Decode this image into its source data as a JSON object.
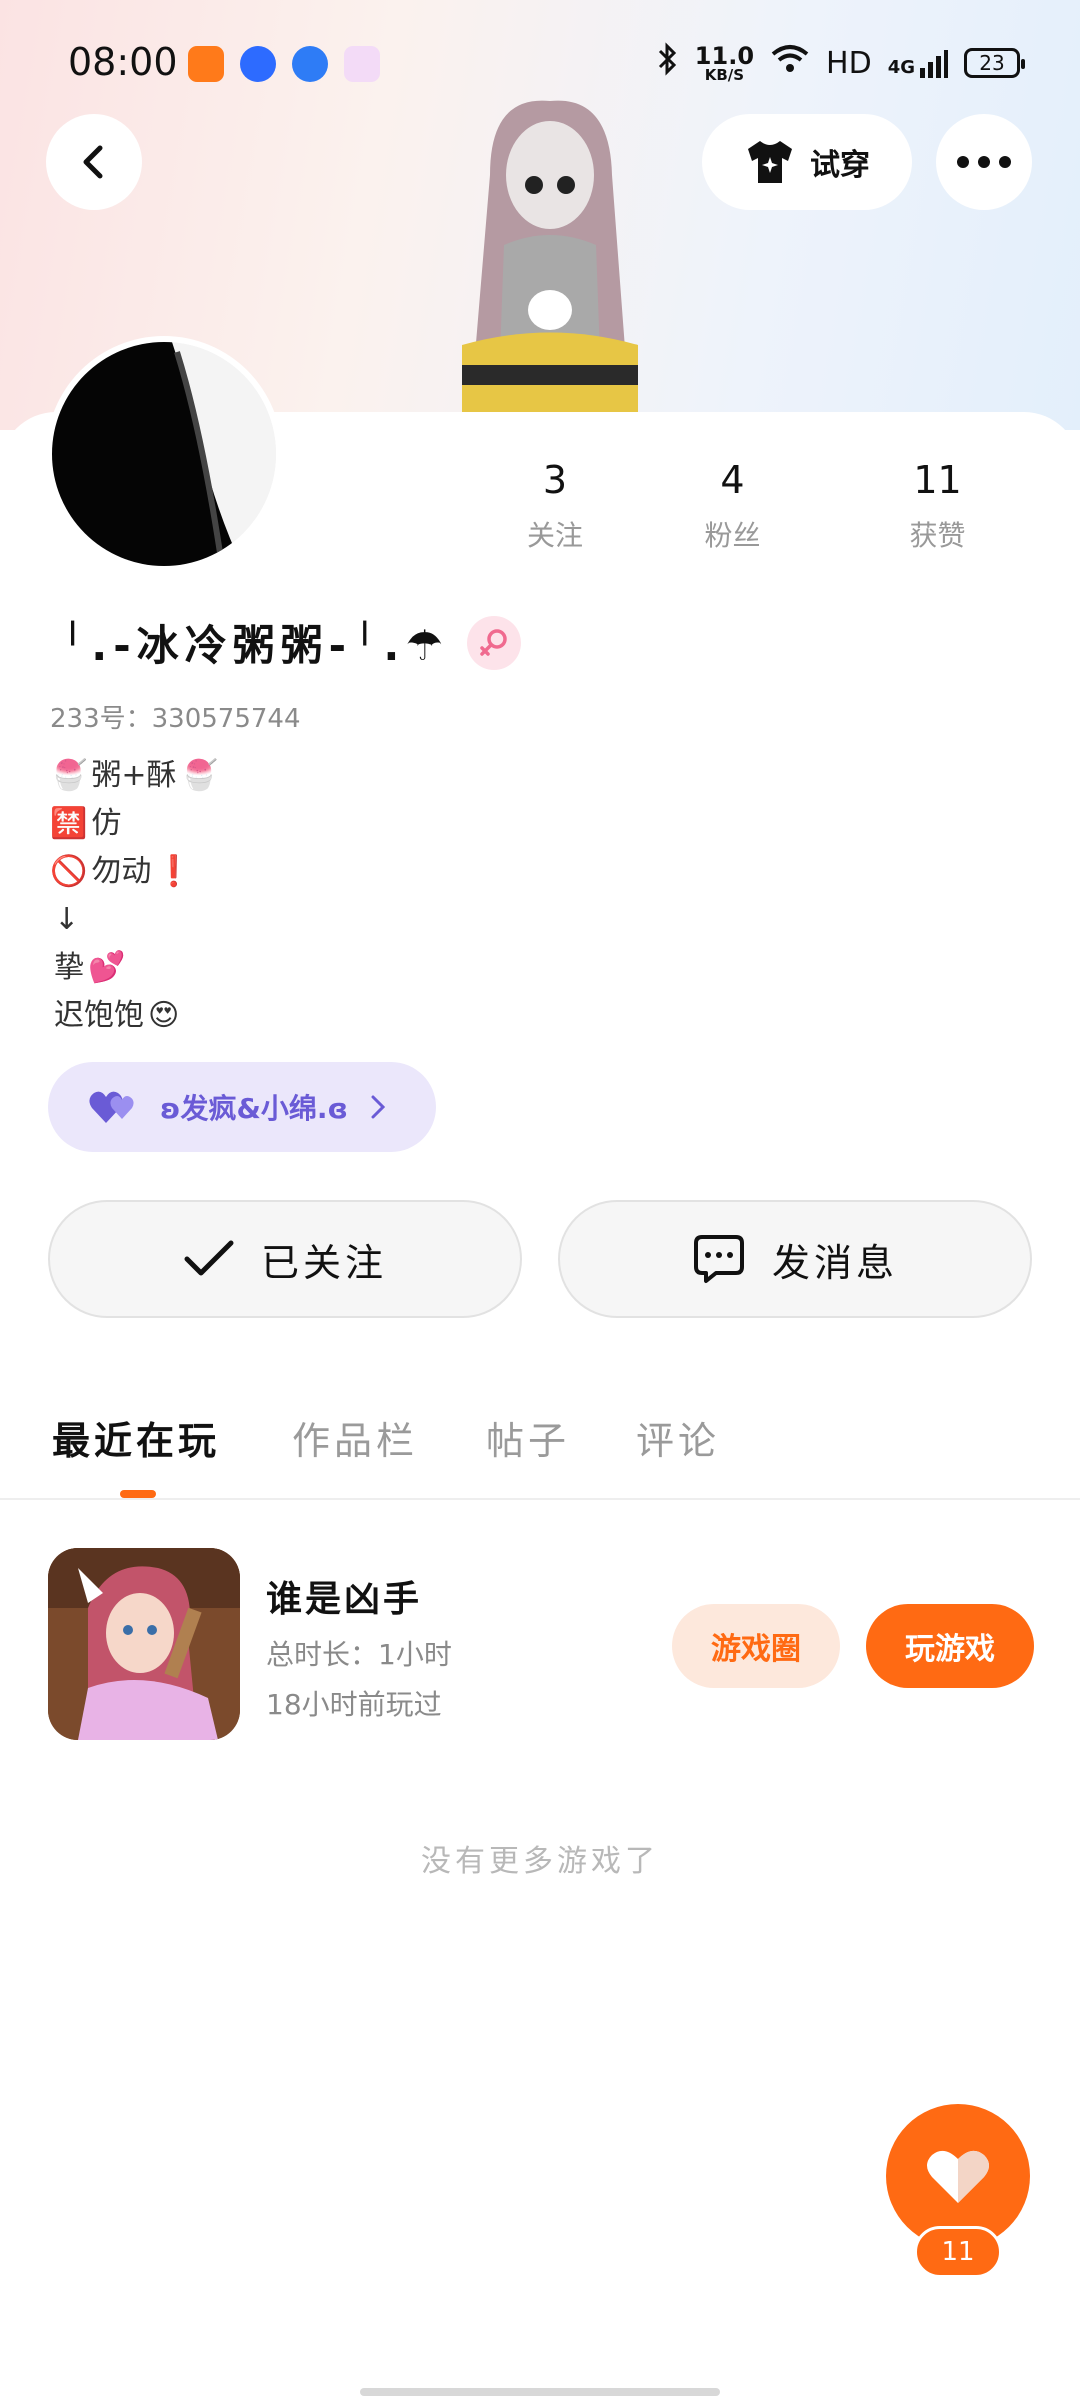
{
  "status_bar": {
    "time": "08:00",
    "net_speed_value": "11.0",
    "net_speed_unit": "KB/S",
    "hd_label": "HD",
    "signal_label": "4G",
    "battery": "23"
  },
  "header": {
    "try_on_label": "试穿"
  },
  "profile": {
    "name": "╵.-冰冷粥粥-╵.☂",
    "uid_label": "233号：",
    "uid_value": "330575744",
    "stats": [
      {
        "value": "3",
        "label": "关注"
      },
      {
        "value": "4",
        "label": "粉丝"
      },
      {
        "value": "11",
        "label": "获赞"
      }
    ],
    "bio": [
      {
        "prefix": "🍧",
        "text": "粥+酥",
        "suffix": "🍧"
      },
      {
        "prefix": "🈲",
        "text": "仿",
        "suffix": ""
      },
      {
        "prefix": "🚫",
        "text": "勿动",
        "suffix": "❗"
      },
      {
        "prefix": "",
        "text": "↓",
        "suffix": ""
      },
      {
        "prefix": "",
        "text": "挚",
        "suffix": "💕"
      },
      {
        "prefix": "",
        "text": "迟饱饱",
        "suffix": "😍"
      }
    ],
    "pair_badge": "ʚ发疯&小绵.ɞ"
  },
  "actions": {
    "follow_label": "已关注",
    "message_label": "发消息"
  },
  "tabs": [
    {
      "label": "最近在玩",
      "active": true
    },
    {
      "label": "作品栏",
      "active": false
    },
    {
      "label": "帖子",
      "active": false
    },
    {
      "label": "评论",
      "active": false
    }
  ],
  "game": {
    "title": "谁是凶手",
    "duration": "总时长：1小时",
    "last_played": "18小时前玩过",
    "circle_label": "游戏圈",
    "play_label": "玩游戏"
  },
  "footer": {
    "no_more": "没有更多游戏了",
    "like_count": "11"
  },
  "colors": {
    "accent": "#ff6a13",
    "badge_bg": "#ebe7fb",
    "badge_text": "#6a5bd6"
  }
}
